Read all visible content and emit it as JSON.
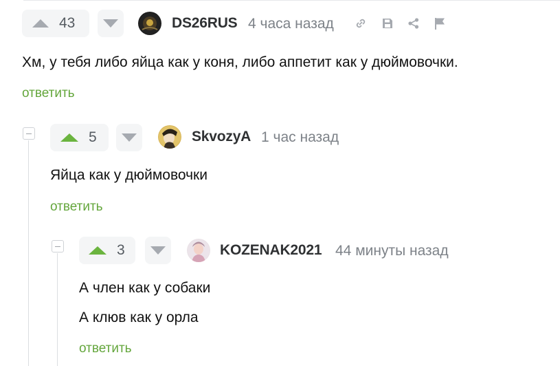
{
  "comments": [
    {
      "rating": "43",
      "username": "DS26RUS",
      "time": "4 часа назад",
      "lines": [
        "Хм, у тебя либо яйца как у коня, либо аппетит как у дюймовочки."
      ],
      "reply_label": "ответить",
      "upvoted": false
    },
    {
      "rating": "5",
      "username": "SkvozyA",
      "time": "1 час назад",
      "lines": [
        "Яйца как у дюймовочки"
      ],
      "reply_label": "ответить",
      "upvoted": true
    },
    {
      "rating": "3",
      "username": "KOZENAK2021",
      "time": "44 минуты назад",
      "lines": [
        "А член как у собаки",
        "А клюв как у орла"
      ],
      "reply_label": "ответить",
      "upvoted": true
    }
  ],
  "icons": [
    "link-icon",
    "save-icon",
    "share-icon",
    "flag-icon",
    "collapse-icon"
  ],
  "colors": {
    "upvote_active": "#6bb43f",
    "vote_inactive": "#a6aab0",
    "reply_link": "#64a63c",
    "vote_bg": "#f4f5f6"
  }
}
